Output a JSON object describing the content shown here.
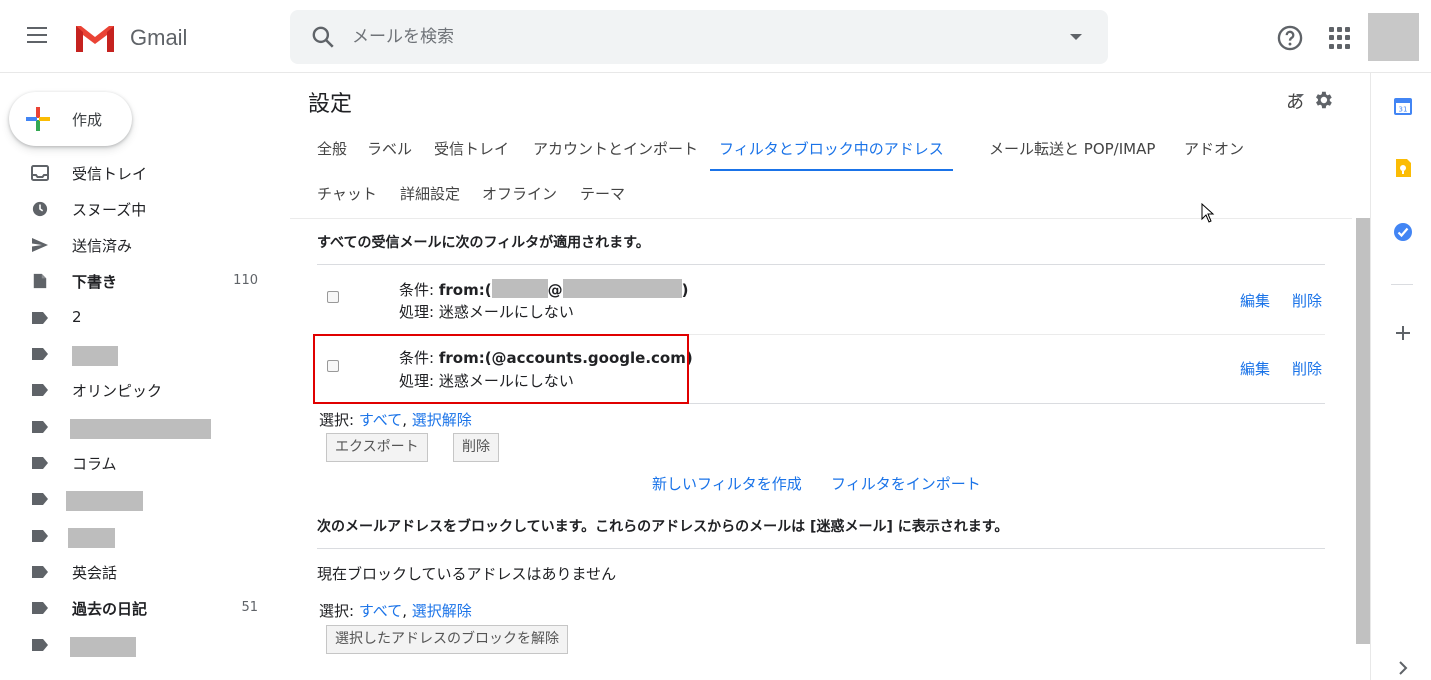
{
  "header": {
    "app_name": "Gmail",
    "search_placeholder": "メールを検索"
  },
  "compose": {
    "label": "作成"
  },
  "sidebar": {
    "items": [
      {
        "label": "受信トレイ",
        "icon": "inbox-icon",
        "bold": false,
        "count": ""
      },
      {
        "label": "スヌーズ中",
        "icon": "clock-icon",
        "bold": false,
        "count": ""
      },
      {
        "label": "送信済み",
        "icon": "send-icon",
        "bold": false,
        "count": ""
      },
      {
        "label": "下書き",
        "icon": "draft-icon",
        "bold": true,
        "count": "110"
      },
      {
        "label": "2",
        "icon": "label-icon",
        "bold": false,
        "count": ""
      },
      {
        "label": "",
        "icon": "label-icon",
        "bold": false,
        "count": "",
        "redacted": true
      },
      {
        "label": "オリンピック",
        "icon": "label-icon",
        "bold": false,
        "count": ""
      },
      {
        "label": "",
        "icon": "label-icon",
        "bold": false,
        "count": "",
        "redacted": true
      },
      {
        "label": "コラム",
        "icon": "label-icon",
        "bold": false,
        "count": ""
      },
      {
        "label": "",
        "icon": "label-icon",
        "bold": false,
        "count": "",
        "redacted": true
      },
      {
        "label": "",
        "icon": "label-icon",
        "bold": false,
        "count": "",
        "redacted": true
      },
      {
        "label": "英会話",
        "icon": "label-icon",
        "bold": false,
        "count": ""
      },
      {
        "label": "過去の日記",
        "icon": "label-icon",
        "bold": true,
        "count": "51"
      },
      {
        "label": "",
        "icon": "label-icon",
        "bold": false,
        "count": "",
        "redacted": true
      }
    ]
  },
  "main": {
    "title": "設定",
    "input_tool": "あ",
    "tabs": [
      {
        "label": "全般",
        "active": false
      },
      {
        "label": "ラベル",
        "active": false
      },
      {
        "label": "受信トレイ",
        "active": false
      },
      {
        "label": "アカウントとインポート",
        "active": false
      },
      {
        "label": "フィルタとブロック中のアドレス",
        "active": true
      },
      {
        "label": "メール転送と POP/IMAP",
        "active": false
      },
      {
        "label": "アドオン",
        "active": false
      },
      {
        "label": "チャット",
        "active": false
      },
      {
        "label": "詳細設定",
        "active": false
      },
      {
        "label": "オフライン",
        "active": false
      },
      {
        "label": "テーマ",
        "active": false
      }
    ],
    "filters_heading": "すべての受信メールに次のフィルタが適用されます。",
    "filters": [
      {
        "condition_label": "条件:",
        "condition_prefix": "from:(",
        "condition_at": "@",
        "condition_suffix": ")",
        "action_label": "処理:",
        "action": "迷惑メールにしない",
        "edit": "編集",
        "delete": "削除"
      },
      {
        "condition_label": "条件:",
        "condition_value": "from:(@accounts.google.com)",
        "action_label": "処理:",
        "action": "迷惑メールにしない",
        "edit": "編集",
        "delete": "削除"
      }
    ],
    "select_label": "選択:",
    "select_all": "すべて",
    "comma": ",",
    "select_none": "選択解除",
    "export_button": "エクスポート",
    "delete_button": "削除",
    "create_filter": "新しいフィルタを作成",
    "import_filter": "フィルタをインポート",
    "blocked_heading": "次のメールアドレスをブロックしています。これらのアドレスからのメールは [迷惑メール] に表示されます。",
    "blocked_empty": "現在ブロックしているアドレスはありません",
    "unblock_button": "選択したアドレスのブロックを解除"
  },
  "colors": {
    "accent": "#1a73e8",
    "highlight_box": "#e00000",
    "redaction": "#bdbdbd"
  }
}
